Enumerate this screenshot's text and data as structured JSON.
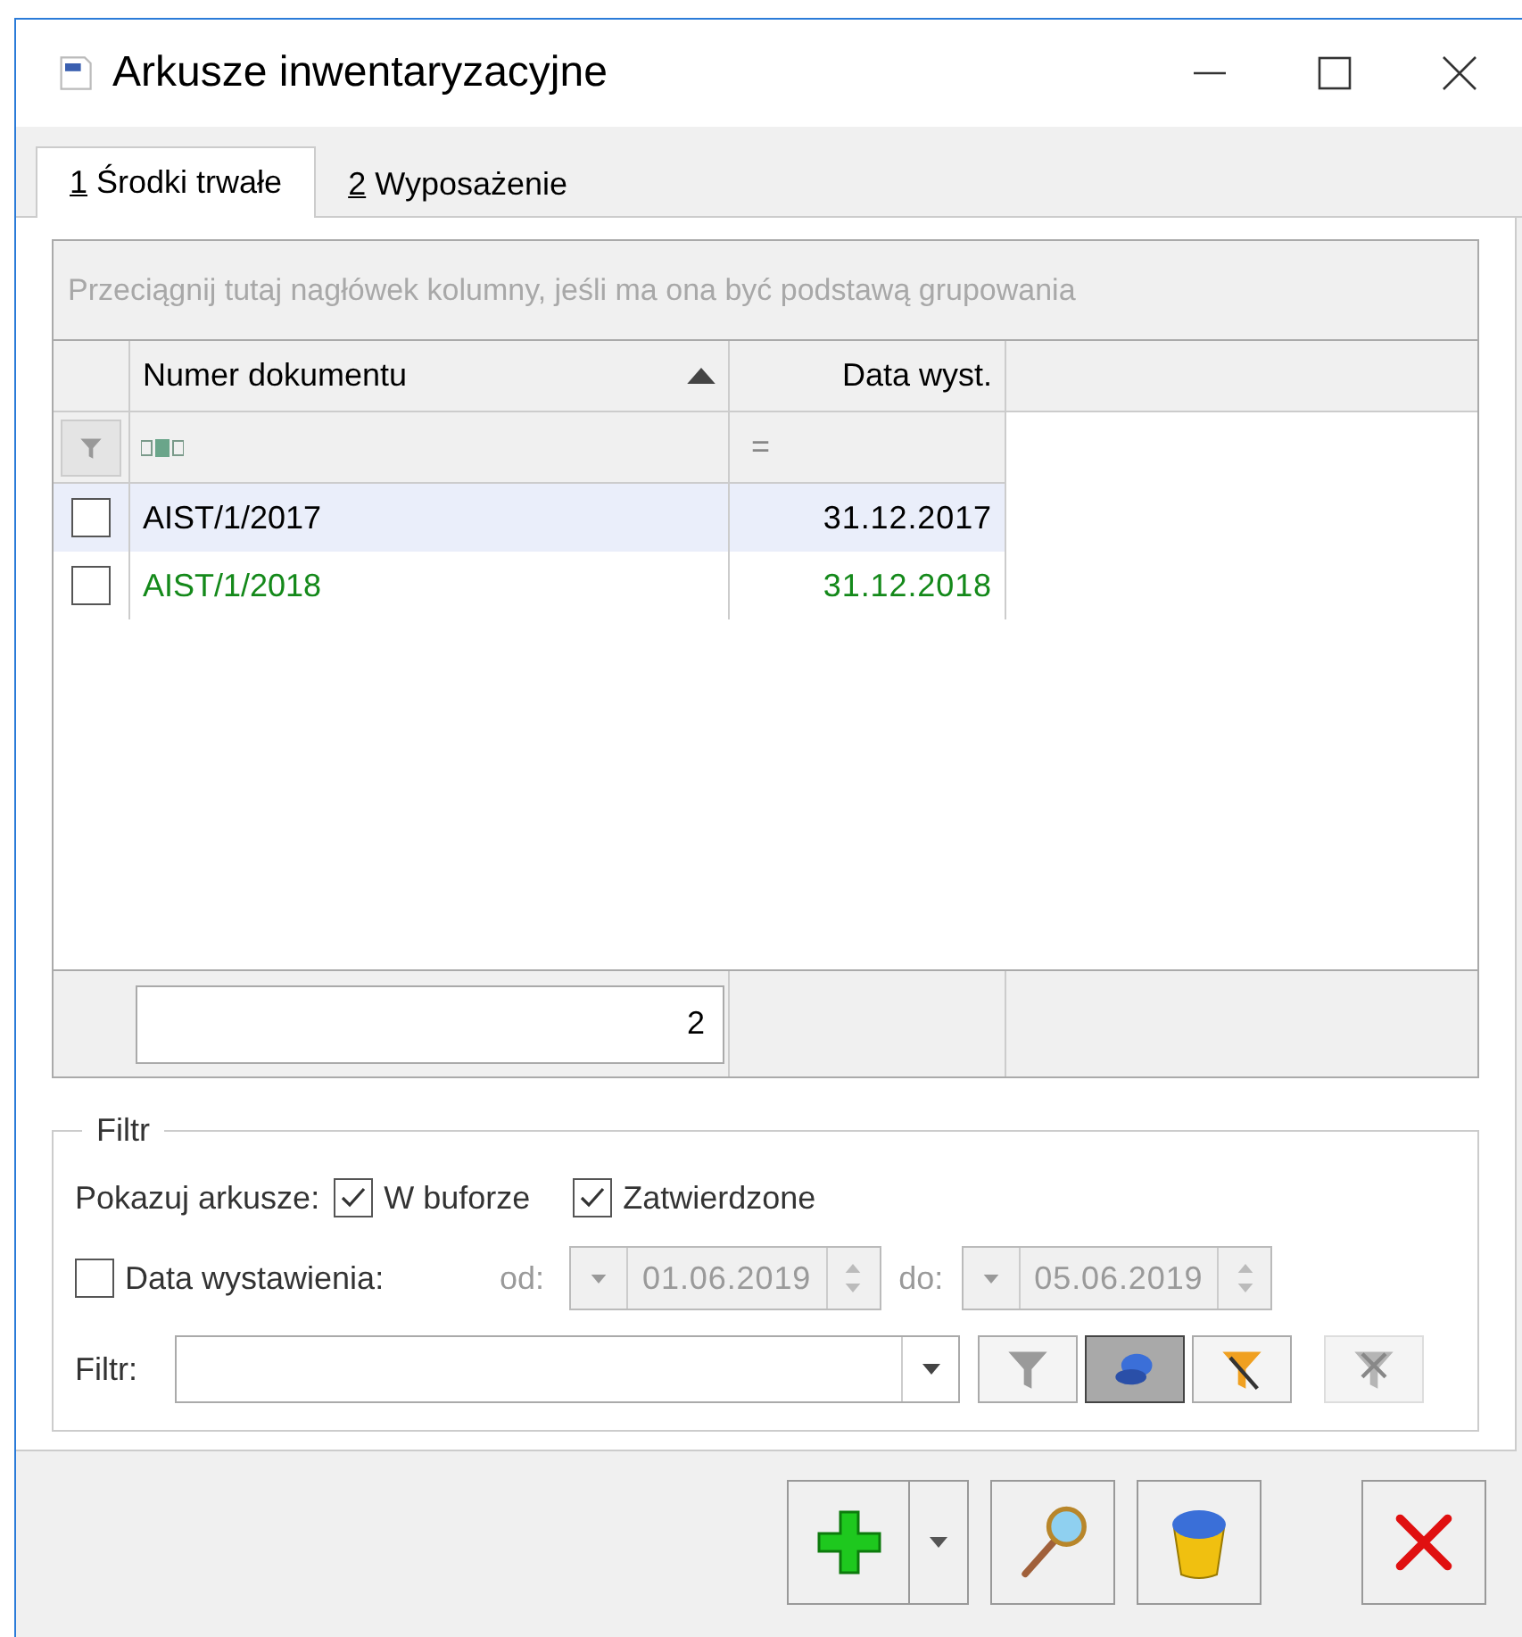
{
  "window": {
    "title": "Arkusze inwentaryzacyjne"
  },
  "tabs": [
    {
      "hotkey": "1",
      "label": "Środki trwałe",
      "selected": true
    },
    {
      "hotkey": "2",
      "label": "Wyposażenie",
      "selected": false
    }
  ],
  "grid": {
    "group_hint": "Przeciągnij tutaj nagłówek kolumny, jeśli ma ona być podstawą grupowania",
    "columns": [
      {
        "label": "Numer dokumentu",
        "sorted": true
      },
      {
        "label": "Data wyst.",
        "sorted": false
      }
    ],
    "date_filter_operator": "=",
    "rows": [
      {
        "checked": false,
        "selected": true,
        "color": "#000000",
        "number": "AIST/1/2017",
        "date": "31.12.2017"
      },
      {
        "checked": false,
        "selected": false,
        "color": "#14891a",
        "number": "AIST/1/2018",
        "date": "31.12.2018"
      }
    ],
    "count": "2"
  },
  "filter": {
    "title": "Filtr",
    "show_label": "Pokazuj arkusze:",
    "options": [
      {
        "label": "W buforze",
        "checked": true
      },
      {
        "label": "Zatwierdzone",
        "checked": true
      }
    ],
    "date": {
      "checked": false,
      "label": "Data wystawienia:",
      "from_label": "od:",
      "from": "01.06.2019",
      "to_label": "do:",
      "to": "05.06.2019"
    },
    "filter_label": "Filtr:",
    "tools": [
      {
        "pressed": false,
        "disabled": false
      },
      {
        "pressed": true,
        "disabled": false
      },
      {
        "pressed": false,
        "disabled": false
      },
      {
        "pressed": false,
        "disabled": true
      }
    ]
  }
}
